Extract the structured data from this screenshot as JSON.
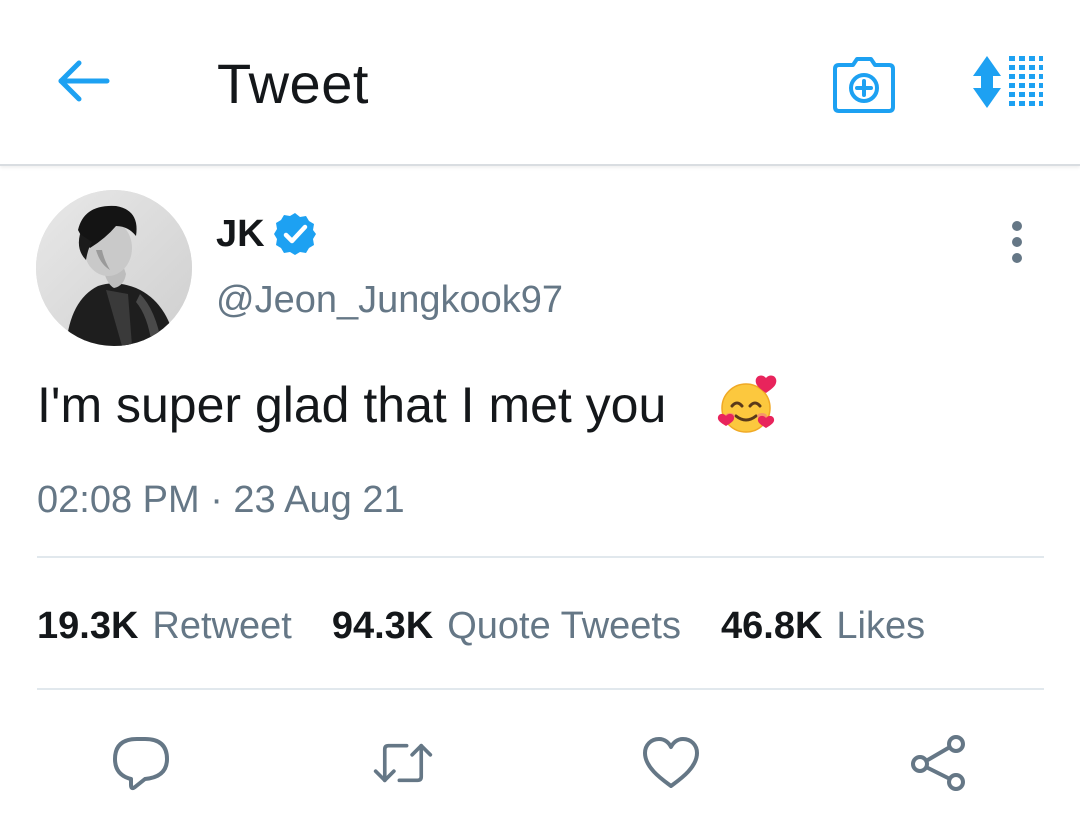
{
  "header": {
    "title": "Tweet",
    "back_icon": "arrow-left-icon",
    "camera_icon": "camera-add-icon",
    "sort_icon": "sort-lines-icon",
    "accent_color": "#1da1f2"
  },
  "author": {
    "name": "JK",
    "handle": "@Jeon_Jungkook97",
    "verified": true,
    "avatar_icon": "profile-photo-avatar",
    "more_icon": "more-vertical-icon"
  },
  "tweet": {
    "text": "I'm super glad that I met you",
    "emoji_icon": "smiling-face-with-hearts-icon",
    "time": "02:08 PM · 23 Aug 21"
  },
  "stats": [
    {
      "count": "19.3K",
      "label": "Retweet"
    },
    {
      "count": "94.3K",
      "label": "Quote Tweets"
    },
    {
      "count": "46.8K",
      "label": "Likes"
    }
  ],
  "actions": {
    "reply_icon": "reply-bubble-icon",
    "retweet_icon": "retweet-icon",
    "like_icon": "heart-icon",
    "share_icon": "share-icon",
    "icon_color": "#657786"
  },
  "colors": {
    "text_primary": "#14171a",
    "text_secondary": "#657786",
    "divider": "#e1e8ed"
  }
}
